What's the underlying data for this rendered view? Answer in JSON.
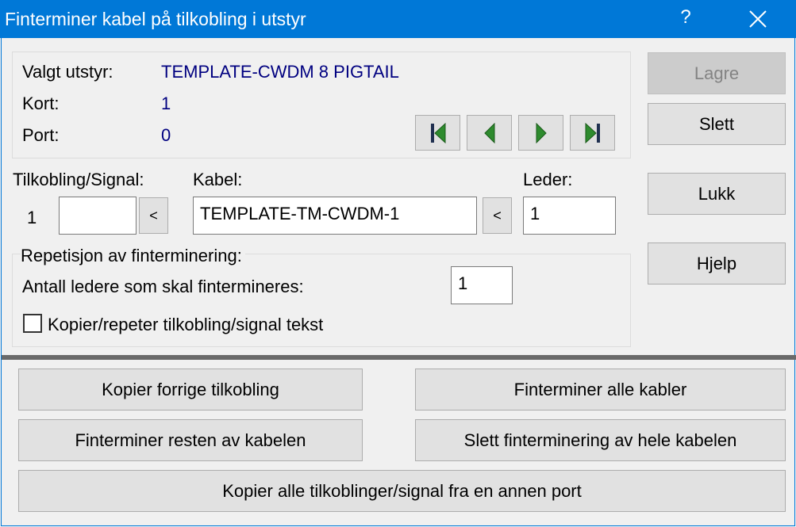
{
  "window": {
    "title": "Finterminer kabel på tilkobling i utstyr",
    "help_label": "?"
  },
  "info": {
    "equipment_label": "Valgt utstyr:",
    "equipment_value": "TEMPLATE-CWDM 8 PIGTAIL",
    "card_label": "Kort:",
    "card_value": "1",
    "port_label": "Port:",
    "port_value": "0"
  },
  "nav_icons": [
    "first-icon",
    "previous-icon",
    "next-icon",
    "last-icon"
  ],
  "side_buttons": {
    "save": "Lagre",
    "delete": "Slett",
    "close": "Lukk",
    "help": "Hjelp"
  },
  "connection": {
    "signal_label": "Tilkobling/Signal:",
    "signal_index": "1",
    "signal_value": "",
    "signal_pick": "<",
    "cable_label": "Kabel:",
    "cable_value": "TEMPLATE-TM-CWDM-1",
    "cable_pick": "<",
    "conductor_label": "Leder:",
    "conductor_value": "1"
  },
  "repetition": {
    "heading": "Repetisjon av finterminering:",
    "count_label": "Antall ledere som skal fintermineres:",
    "count_value": "1",
    "copy_text_label": "Kopier/repeter tilkobling/signal tekst",
    "copy_text_checked": false
  },
  "actions": {
    "copy_previous": "Kopier forrige tilkobling",
    "terminate_all": "Finterminer alle kabler",
    "terminate_rest": "Finterminer resten av kabelen",
    "delete_all_termination": "Slett finterminering av hele kabelen",
    "copy_from_port": "Kopier alle tilkoblinger/signal fra en annen port"
  },
  "colors": {
    "titlebar": "#0078d7",
    "value_text": "#000080",
    "nav_arrow": "#2e8b2e"
  }
}
